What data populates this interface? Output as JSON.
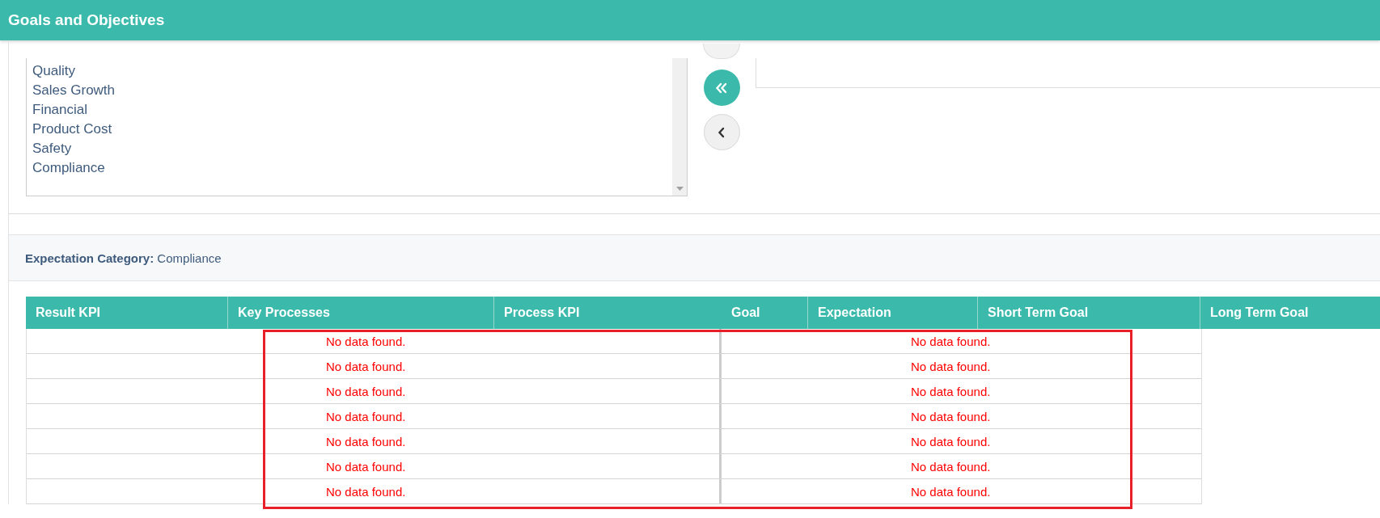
{
  "header": {
    "title": "Goals and Objectives"
  },
  "category_list": {
    "items": [
      "Quality",
      "Sales Growth",
      "Financial",
      "Product Cost",
      "Safety",
      "Compliance"
    ]
  },
  "transfer_buttons": [
    {
      "kind": "move_all_left"
    },
    {
      "kind": "move_left"
    }
  ],
  "expectation": {
    "label": "Expectation Category:",
    "value": "Compliance"
  },
  "table": {
    "columns": [
      "Result KPI",
      "Key Processes",
      "Process KPI",
      "Goal",
      "Expectation",
      "Short Term Goal",
      "Long Term Goal"
    ],
    "rows": [
      {
        "messages": [
          "No data found.",
          "No data found."
        ]
      },
      {
        "messages": [
          "No data found.",
          "No data found."
        ]
      },
      {
        "messages": [
          "No data found.",
          "No data found."
        ]
      },
      {
        "messages": [
          "No data found.",
          "No data found."
        ]
      },
      {
        "messages": [
          "No data found.",
          "No data found."
        ]
      },
      {
        "messages": [
          "No data found.",
          "No data found."
        ]
      },
      {
        "messages": [
          "No data found.",
          "No data found."
        ]
      }
    ]
  }
}
